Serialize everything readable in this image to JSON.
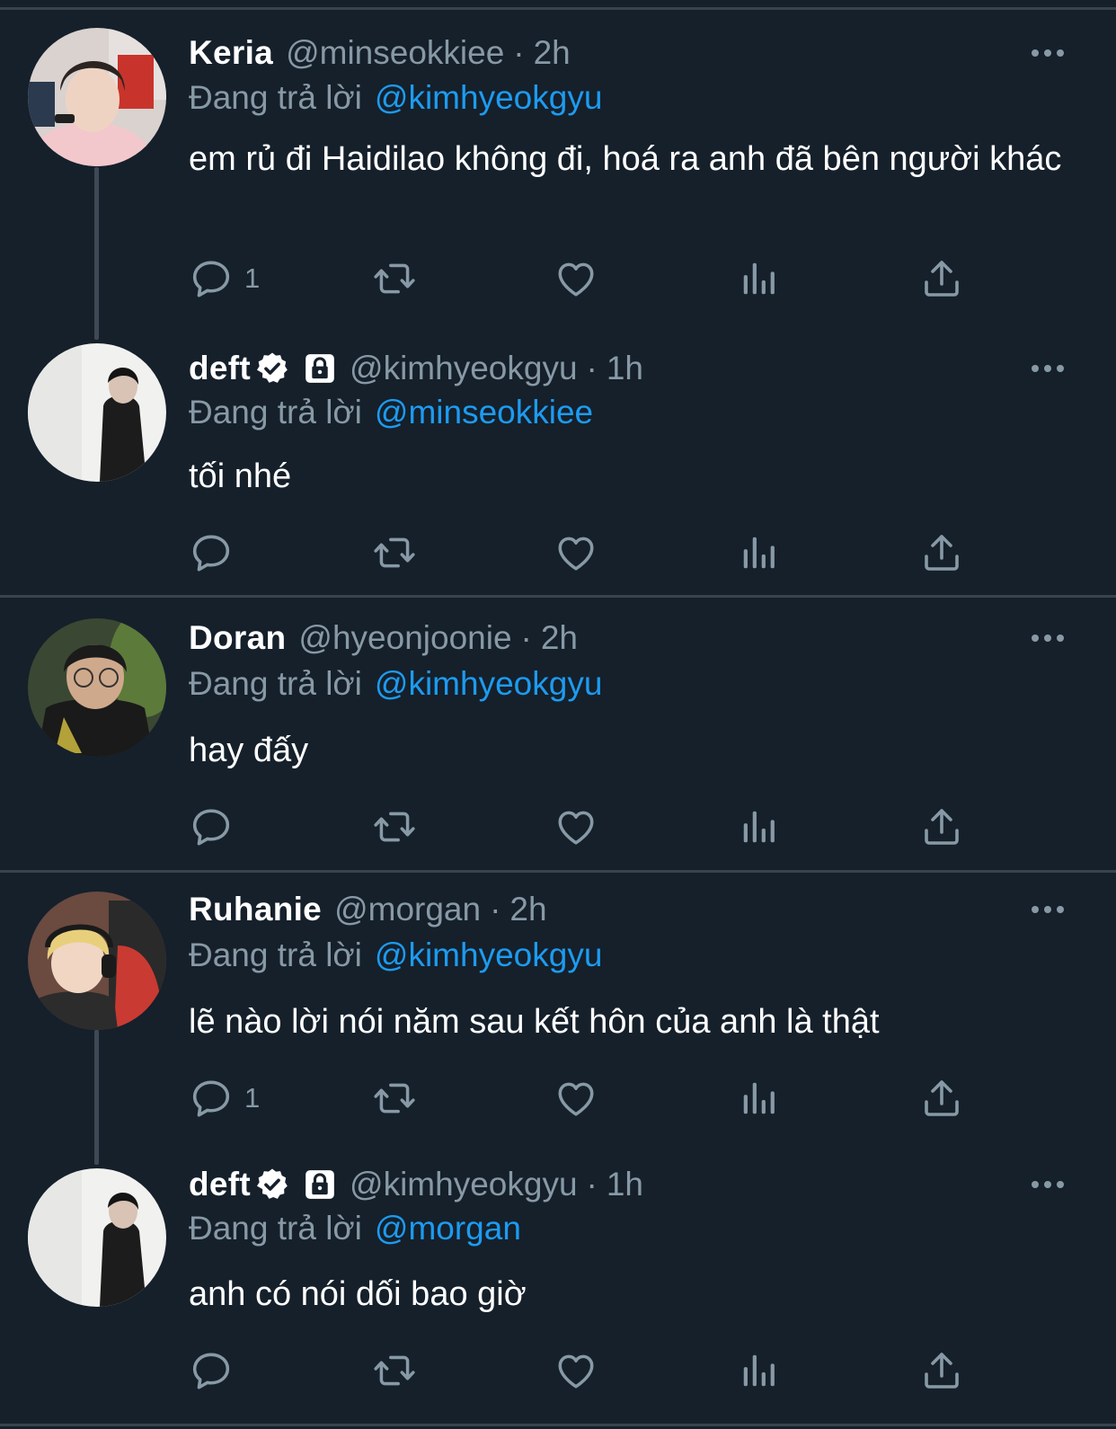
{
  "colors": {
    "background": "#15202b",
    "secondary_text": "#8899a6",
    "mention": "#1d9bf0",
    "divider": "#38444d"
  },
  "replying_prefix": "Đang trả lời",
  "tweets": [
    {
      "name": "Keria",
      "handle": "@minseokkiee",
      "separator": "·",
      "time": "2h",
      "verified": false,
      "protected": false,
      "reply_to": "@kimhyeokgyu",
      "text": "em rủ đi Haidilao không đi, hoá ra anh đã bên người khác",
      "reply_count": "1",
      "avatar_icon": "avatar-keria"
    },
    {
      "name": "deft",
      "handle": "@kimhyeokgyu",
      "separator": "·",
      "time": "1h",
      "verified": true,
      "protected": true,
      "reply_to": "@minseokkiee",
      "text": "tối nhé",
      "reply_count": "",
      "avatar_icon": "avatar-deft"
    },
    {
      "name": "Doran",
      "handle": "@hyeonjoonie",
      "separator": "·",
      "time": "2h",
      "verified": false,
      "protected": false,
      "reply_to": "@kimhyeokgyu",
      "text": "hay đấy",
      "reply_count": "",
      "avatar_icon": "avatar-doran"
    },
    {
      "name": "Ruhanie",
      "handle": "@morgan",
      "separator": "·",
      "time": "2h",
      "verified": false,
      "protected": false,
      "reply_to": "@kimhyeokgyu",
      "text": "lẽ nào lời nói năm sau kết hôn của anh là thật",
      "reply_count": "1",
      "avatar_icon": "avatar-ruhanie"
    },
    {
      "name": "deft",
      "handle": "@kimhyeokgyu",
      "separator": "·",
      "time": "1h",
      "verified": true,
      "protected": true,
      "reply_to": "@morgan",
      "text": "anh có nói dối bao giờ",
      "reply_count": "",
      "avatar_icon": "avatar-deft"
    }
  ]
}
